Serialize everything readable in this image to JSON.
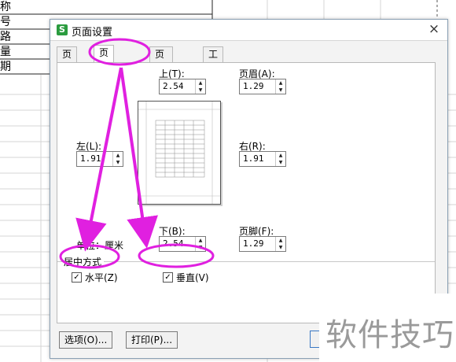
{
  "sheet": {
    "col_labels": [
      "称",
      "号",
      "路",
      "量",
      "期"
    ]
  },
  "dialog": {
    "title": "页面设置",
    "close": "×",
    "tabs": [
      {
        "label": "页面"
      },
      {
        "label": "页边距"
      },
      {
        "label": "页眉/页脚"
      },
      {
        "label": "工作表"
      }
    ],
    "margins": {
      "top": {
        "label": "上(T):",
        "value": "2.54"
      },
      "bottom": {
        "label": "下(B):",
        "value": "2.54"
      },
      "left": {
        "label": "左(L):",
        "value": "1.91"
      },
      "right": {
        "label": "右(R):",
        "value": "1.91"
      },
      "header": {
        "label": "页眉(A):",
        "value": "1.29"
      },
      "footer": {
        "label": "页脚(F):",
        "value": "1.29"
      }
    },
    "unit": {
      "label": "单位：",
      "value": "厘米"
    },
    "center": {
      "title": "居中方式",
      "horizontal": {
        "label": "水平(Z)",
        "checked": true
      },
      "vertical": {
        "label": "垂直(V)",
        "checked": true
      }
    },
    "buttons": {
      "options": "选项(O)...",
      "print": "打印(P)..."
    }
  },
  "watermark": "软件技巧",
  "colors": {
    "annotation": "#e020e0",
    "app_icon": "#2b9c3f"
  }
}
